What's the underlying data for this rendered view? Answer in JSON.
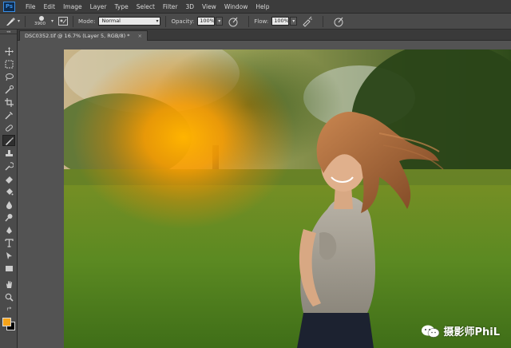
{
  "app": {
    "logo": "Ps"
  },
  "menu": [
    "File",
    "Edit",
    "Image",
    "Layer",
    "Type",
    "Select",
    "Filter",
    "3D",
    "View",
    "Window",
    "Help"
  ],
  "options": {
    "brush_size": "3900",
    "mode_label": "Mode:",
    "mode_value": "Normal",
    "opacity_label": "Opacity:",
    "opacity_value": "100%",
    "flow_label": "Flow:",
    "flow_value": "100%"
  },
  "document": {
    "tab_title": "DSC0352.tif @ 16.7% (Layer 5, RGB/8) *",
    "close_glyph": "×"
  },
  "colors": {
    "foreground": "#f5a31a",
    "background": "#000000"
  },
  "watermark": {
    "text": "摄影师PhiL"
  }
}
